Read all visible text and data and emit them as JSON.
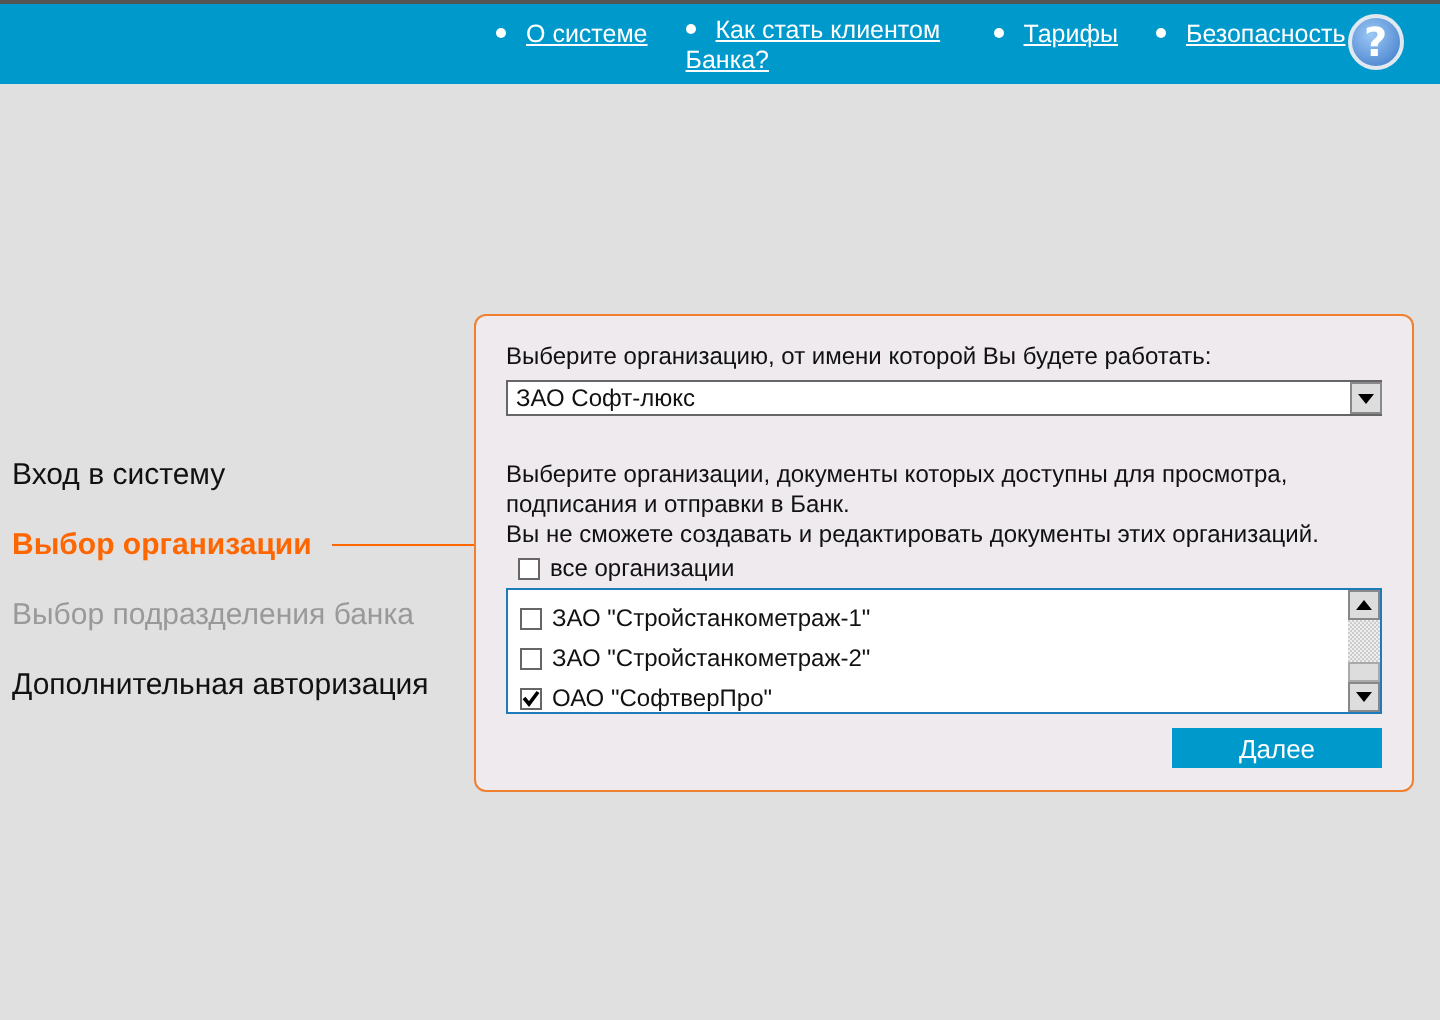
{
  "top_nav": {
    "links": [
      {
        "label": "О системе"
      },
      {
        "label": "Как стать клиентом Банка?"
      },
      {
        "label": "Тарифы"
      },
      {
        "label": "Безопасность"
      }
    ],
    "help": "?"
  },
  "steps": [
    {
      "label": "Вход в систему",
      "selected": false,
      "disabled": false
    },
    {
      "label": "Выбор организации",
      "selected": true,
      "disabled": false
    },
    {
      "label": "Выбор подразделения банка",
      "selected": false,
      "disabled": true
    },
    {
      "label": "Дополнительная авторизация",
      "selected": false,
      "disabled": false
    }
  ],
  "panel": {
    "select_label": "Выберите организацию, от имени которой Вы будете работать:",
    "select_value": "ЗАО Софт-люкс",
    "info_lines": [
      "Выберите организации, документы которых доступны для просмотра, подписания и отправки в Банк.",
      "Вы не сможете создавать и редактировать документы этих организаций."
    ],
    "all_option": {
      "label": "все организации",
      "checked": false
    },
    "organizations": [
      {
        "label": "ЗАО \"Стройстанкометраж-1\"",
        "checked": false
      },
      {
        "label": "ЗАО \"Стройстанкометраж-2\"",
        "checked": false
      },
      {
        "label": "ОАО \"СофтверПро\"",
        "checked": true
      }
    ],
    "next_button": "Далее"
  }
}
